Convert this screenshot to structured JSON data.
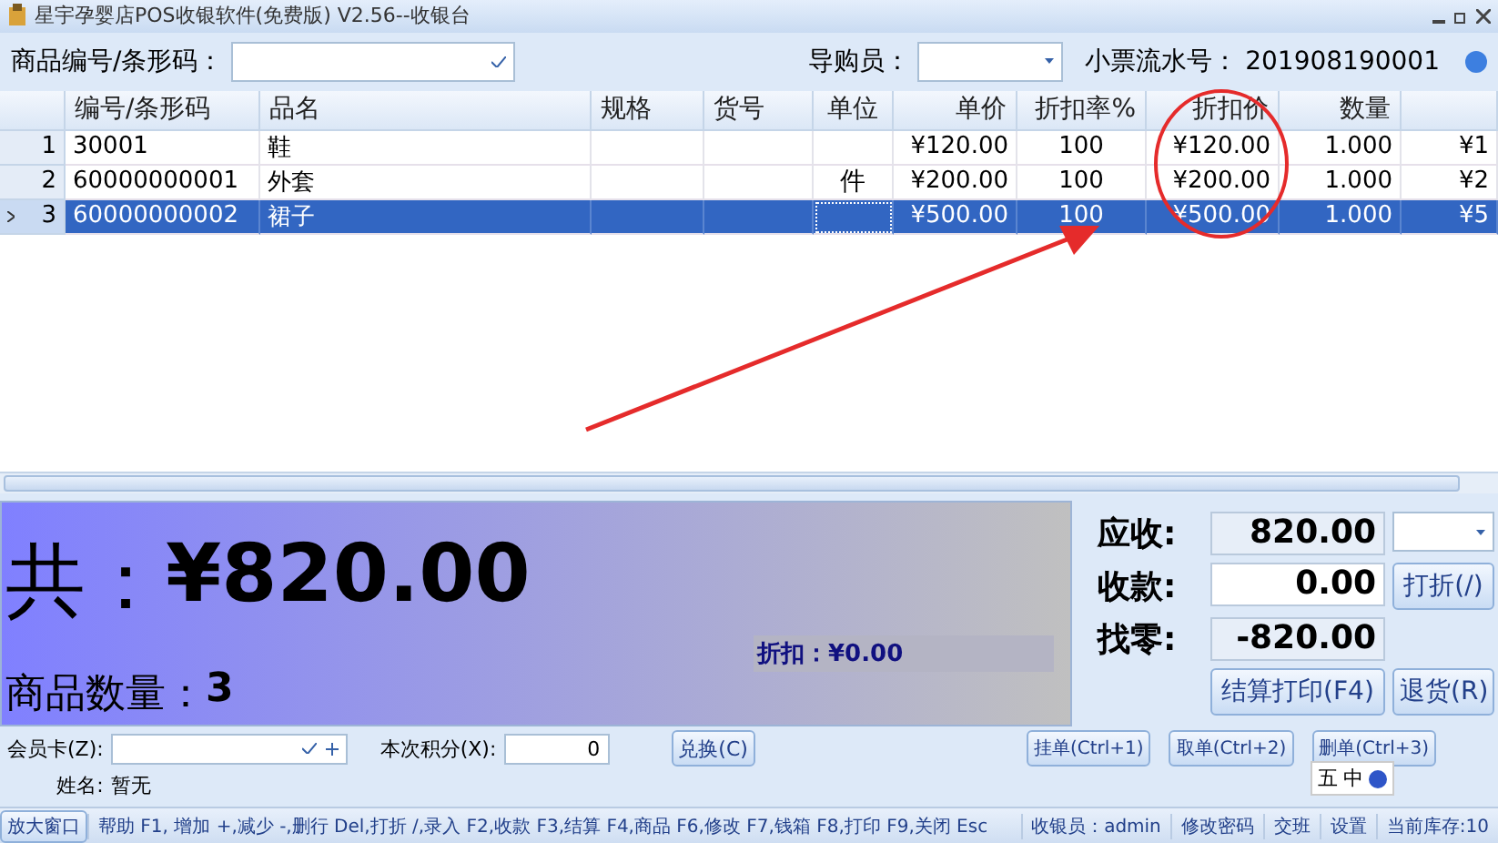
{
  "window": {
    "title": "星宇孕婴店POS收银软件(免费版) V2.56--收银台"
  },
  "toolbar": {
    "barcode_label": "商品编号/条形码：",
    "guide_label": "导购员：",
    "receipt_label": "小票流水号：",
    "receipt_no": "201908190001"
  },
  "table": {
    "columns": [
      "编号/条形码",
      "品名",
      "规格",
      "货号",
      "单位",
      "单价",
      "折扣率%",
      "折扣价",
      "数量"
    ],
    "rows": [
      {
        "num": "1",
        "cells": [
          "30001",
          "鞋",
          "",
          "",
          "",
          "¥120.00",
          "100",
          "¥120.00",
          "1.000",
          "¥1"
        ],
        "selected": false
      },
      {
        "num": "2",
        "cells": [
          "60000000001",
          "外套",
          "",
          "",
          "件",
          "¥200.00",
          "100",
          "¥200.00",
          "1.000",
          "¥2"
        ],
        "selected": false
      },
      {
        "num": "3",
        "cells": [
          "60000000002",
          "裙子",
          "",
          "",
          "",
          "¥500.00",
          "100",
          "¥500.00",
          "1.000",
          "¥5"
        ],
        "selected": true
      }
    ]
  },
  "total": {
    "label": "共：",
    "amount": "¥820.00",
    "count_label": "商品数量：",
    "count": "3",
    "discount_label": "折扣：",
    "discount": "¥0.00"
  },
  "payment": {
    "fields": [
      {
        "label": "应收:",
        "value": "820.00",
        "editable": false
      },
      {
        "label": "收款:",
        "value": "0.00",
        "editable": true
      },
      {
        "label": "找零:",
        "value": "-820.00",
        "editable": false
      }
    ],
    "discount_button": "打折(/)",
    "checkout_button": "结算打印(F4)",
    "return_button": "退货(R)"
  },
  "member": {
    "card_label": "会员卡(Z):",
    "points_label": "本次积分(X):",
    "points": "0",
    "redeem_button": "兑换(C)",
    "name_label": "姓名:",
    "name": "暂无"
  },
  "actions": [
    "挂单(Ctrl+1)",
    "取单(Ctrl+2)",
    "删单(Ctrl+3)"
  ],
  "ime": [
    "五",
    "中"
  ],
  "status_bar": {
    "enlarge": "放大窗口",
    "help": "帮助 F1, 增加 +,减少 -,删行 Del,打折 /,录入 F2,收款 F3,结算 F4,商品 F6,修改 F7,钱箱 F8,打印 F9,关闭 Esc",
    "items": [
      "收银员：admin",
      "修改密码",
      "交班",
      "设置",
      "当前库存:10"
    ]
  }
}
